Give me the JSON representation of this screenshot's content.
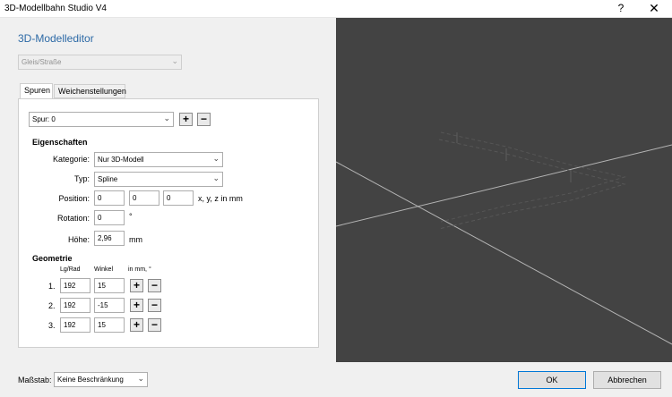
{
  "window": {
    "title": "3D-Modellbahn Studio V4",
    "help_label": "?",
    "close_label": "✕"
  },
  "editor": {
    "title": "3D-Modelleditor",
    "category_select": "Gleis/Straße"
  },
  "tabs": [
    {
      "label": "Spuren"
    },
    {
      "label": "Weichenstellungen"
    }
  ],
  "spur": {
    "select": "Spur: 0",
    "add": "+",
    "remove": "−"
  },
  "eigenschaften": {
    "heading": "Eigenschaften",
    "kategorie_label": "Kategorie:",
    "kategorie_value": "Nur 3D-Modell",
    "typ_label": "Typ:",
    "typ_value": "Spline",
    "position_label": "Position:",
    "position_x": "0",
    "position_y": "0",
    "position_z": "0",
    "position_unit": "x, y, z in mm",
    "rotation_label": "Rotation:",
    "rotation_value": "0",
    "rotation_unit": "°",
    "hoehe_label": "Höhe:",
    "hoehe_value": "2,96",
    "hoehe_unit": "mm"
  },
  "geometrie": {
    "heading": "Geometrie",
    "col_lg": "Lg/Rad",
    "col_winkel": "Winkel",
    "col_unit": "in mm, °",
    "rows": [
      {
        "num": "1.",
        "lg": "192",
        "winkel": "15"
      },
      {
        "num": "2.",
        "lg": "192",
        "winkel": "-15"
      },
      {
        "num": "3.",
        "lg": "192",
        "winkel": "15"
      }
    ],
    "add": "+",
    "remove": "−"
  },
  "footer": {
    "massstab_label": "Maßstab:",
    "massstab_value": "Keine Beschränkung",
    "ok_label": "OK",
    "cancel_label": "Abbrechen"
  },
  "viewport": {
    "background": "#434343",
    "line_color": "#b4b4b4"
  }
}
